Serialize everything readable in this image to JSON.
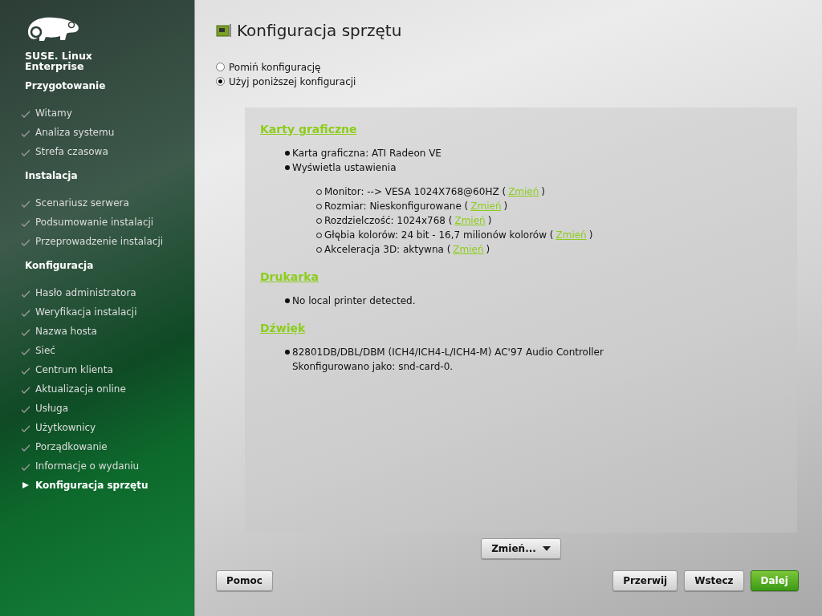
{
  "logo": {
    "lines": [
      "SUSE. Linux",
      "Enterprise"
    ]
  },
  "sidebar": {
    "sections": [
      {
        "title": "Przygotowanie",
        "items": [
          {
            "label": "Witamy",
            "selected": false
          },
          {
            "label": "Analiza systemu",
            "selected": false
          },
          {
            "label": "Strefa czasowa",
            "selected": false
          }
        ]
      },
      {
        "title": "Instalacja",
        "items": [
          {
            "label": "Scenariusz serwera",
            "selected": false
          },
          {
            "label": "Podsumowanie instalacji",
            "selected": false
          },
          {
            "label": "Przeprowadzenie instalacji",
            "selected": false
          }
        ]
      },
      {
        "title": "Konfiguracja",
        "items": [
          {
            "label": "Hasło administratora",
            "selected": false
          },
          {
            "label": "Weryfikacja instalacji",
            "selected": false
          },
          {
            "label": "Nazwa hosta",
            "selected": false
          },
          {
            "label": "Sieć",
            "selected": false
          },
          {
            "label": "Centrum klienta",
            "selected": false
          },
          {
            "label": "Aktualizacja online",
            "selected": false
          },
          {
            "label": "Usługa",
            "selected": false
          },
          {
            "label": "Użytkownicy",
            "selected": false
          },
          {
            "label": "Porządkowanie",
            "selected": false
          },
          {
            "label": "Informacje o wydaniu",
            "selected": false
          },
          {
            "label": "Konfiguracja sprzętu",
            "selected": true
          }
        ]
      }
    ]
  },
  "title": "Konfiguracja sprzętu",
  "options": [
    {
      "label": "Pomiń konfigurację",
      "selected": false
    },
    {
      "label": "Użyj poniższej konfiguracji",
      "selected": true
    }
  ],
  "details": [
    {
      "heading": "Karty graficzne",
      "items": [
        {
          "text": "Karta graficzna: ATI Radeon VE"
        },
        {
          "text": "Wyświetla ustawienia",
          "children": [
            {
              "text": "Monitor: --> VESA 1024X768@60HZ (",
              "link": "Zmień",
              "after": ")"
            },
            {
              "text": "Rozmiar: Nieskonfigurowane (",
              "link": "Zmień",
              "after": ")"
            },
            {
              "text": "Rozdzielczość: 1024x768 (",
              "link": "Zmień",
              "after": ")"
            },
            {
              "text": "Głębia kolorów: 24 bit - 16,7 milionów kolorów (",
              "link": "Zmień",
              "after": ")"
            },
            {
              "text": "Akceleracja 3D: aktywna (",
              "link": "Zmień",
              "after": ")"
            }
          ]
        }
      ]
    },
    {
      "heading": "Drukarka",
      "items": [
        {
          "text": "No local printer detected."
        }
      ]
    },
    {
      "heading": "Dźwięk",
      "items": [
        {
          "text": "82801DB/DBL/DBM (ICH4/ICH4-L/ICH4-M) AC'97 Audio Controller",
          "note": "Skonfigurowano jako: snd-card-0."
        }
      ]
    }
  ],
  "change_button": {
    "label": "Zmień..."
  },
  "buttons": [
    {
      "label": "Pomoc",
      "kind": "plain"
    },
    {
      "label": "Przerwij",
      "kind": "plain"
    },
    {
      "label": "Wstecz",
      "kind": "plain"
    },
    {
      "label": "Dalej",
      "kind": "default"
    }
  ]
}
